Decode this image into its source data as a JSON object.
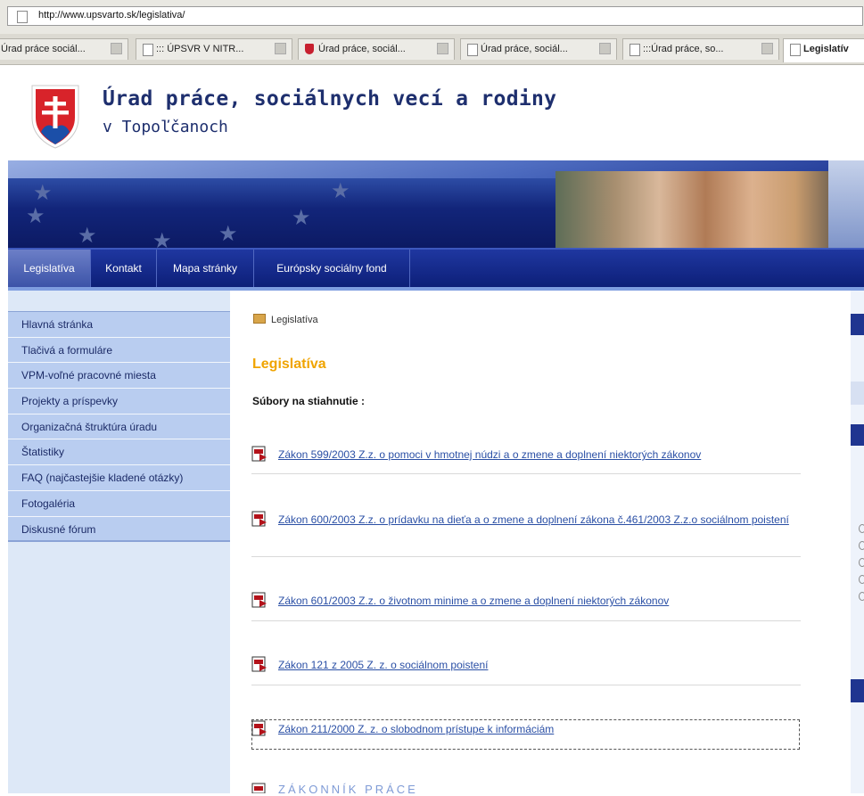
{
  "browser": {
    "url": "http://www.upsvarto.sk/legislativa/",
    "tabs": [
      {
        "label": "Úrad práce sociál..."
      },
      {
        "label": "::: ÚPSVR V NITR..."
      },
      {
        "label": "Úrad práce, sociál..."
      },
      {
        "label": "Úrad práce, sociál..."
      },
      {
        "label": ":::Úrad práce, so..."
      },
      {
        "label": "Legislatív"
      }
    ]
  },
  "header": {
    "title": "Úrad práce, sociálnych vecí a rodiny",
    "subtitle": "v Topoľčanoch"
  },
  "nav": {
    "items": [
      {
        "label": "Legislatíva"
      },
      {
        "label": "Kontakt"
      },
      {
        "label": "Mapa stránky"
      },
      {
        "label": "Európsky sociálny fond"
      }
    ]
  },
  "sidebar": {
    "items": [
      {
        "label": "Hlavná stránka"
      },
      {
        "label": "Tlačivá a formuláre"
      },
      {
        "label": "VPM-voľné pracovné miesta"
      },
      {
        "label": "Projekty a príspevky"
      },
      {
        "label": "Organizačná štruktúra úradu"
      },
      {
        "label": "Štatistiky"
      },
      {
        "label": "FAQ (najčastejšie kladené otázky)"
      },
      {
        "label": "Fotogaléria"
      },
      {
        "label": "Diskusné fórum"
      }
    ]
  },
  "content": {
    "breadcrumb": "Legislatíva",
    "heading": "Legislatíva",
    "downloads_label": "Súbory na stiahnutie :",
    "documents": [
      {
        "label": "Zákon 599/2003 Z.z. o pomoci v hmotnej núdzi a o zmene a doplnení niektorých zákonov"
      },
      {
        "label": "Zákon 600/2003 Z.z. o prídavku na dieťa a o zmene a doplnení zákona č.461/2003 Z.z.o sociálnom poistení"
      },
      {
        "label": "Zákon 601/2003 Z.z. o životnom minime a o zmene a doplnení niektorých zákonov"
      },
      {
        "label": "Zákon 121 z 2005 Z. z. o sociálnom poistení"
      },
      {
        "label": "Zákon 211/2000 Z. z. o slobodnom prístupe k informáciám"
      }
    ],
    "partial_heading": "ZÁKONNÍK PRÁCE"
  },
  "colors": {
    "nav_blue": "#12257a",
    "heading_orange": "#f0a400",
    "link_blue": "#2a4fa5",
    "sidebar_blue": "#b9cdf0"
  }
}
